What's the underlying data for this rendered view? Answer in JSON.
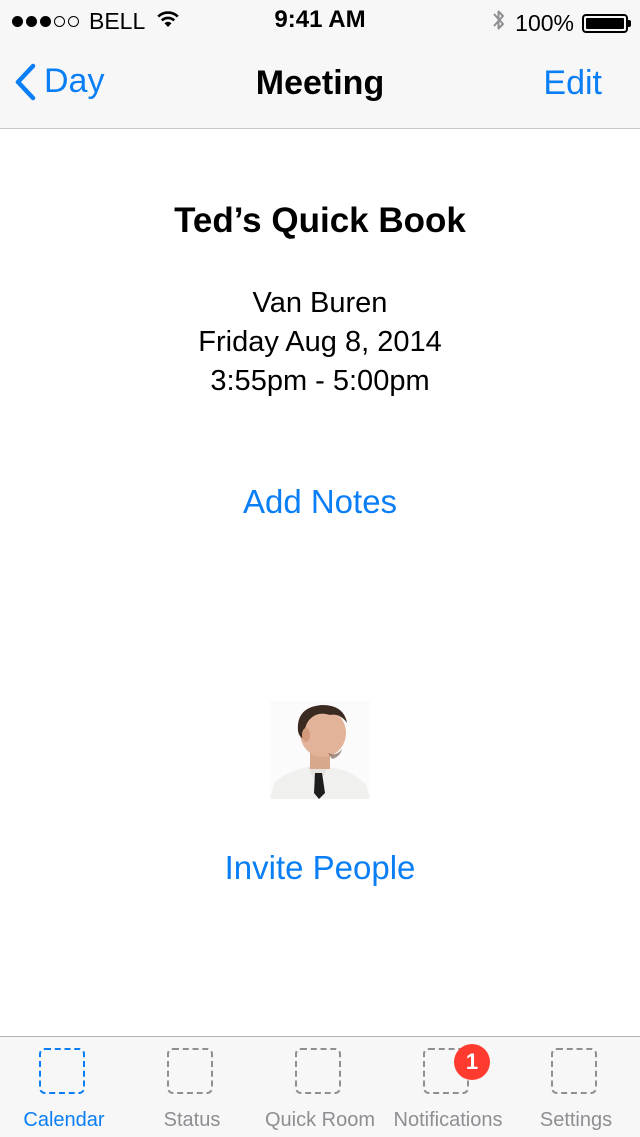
{
  "status_bar": {
    "carrier": "BELL",
    "time": "9:41 AM",
    "battery": "100%",
    "signal_bars_filled": 3,
    "signal_bars_total": 5,
    "icons": [
      "wifi-icon",
      "bluetooth-icon",
      "battery-icon"
    ]
  },
  "nav": {
    "back_label": "Day",
    "title": "Meeting",
    "edit_label": "Edit"
  },
  "meeting": {
    "title": "Ted’s Quick Book",
    "room": "Van Buren",
    "date": "Friday Aug 8, 2014",
    "time_range": "3:55pm - 5:00pm"
  },
  "actions": {
    "add_notes": "Add Notes",
    "invite_people": "Invite People"
  },
  "tabs": [
    {
      "label": "Calendar",
      "active": true
    },
    {
      "label": "Status",
      "active": false
    },
    {
      "label": "Quick Room",
      "active": false
    },
    {
      "label": "Notifications",
      "active": false,
      "badge": "1"
    },
    {
      "label": "Settings",
      "active": false
    }
  ],
  "colors": {
    "accent": "#0a7ff5",
    "badge": "#ff3b30",
    "inactive_tab": "#8e8e93",
    "bar_background": "#f7f7f7"
  }
}
